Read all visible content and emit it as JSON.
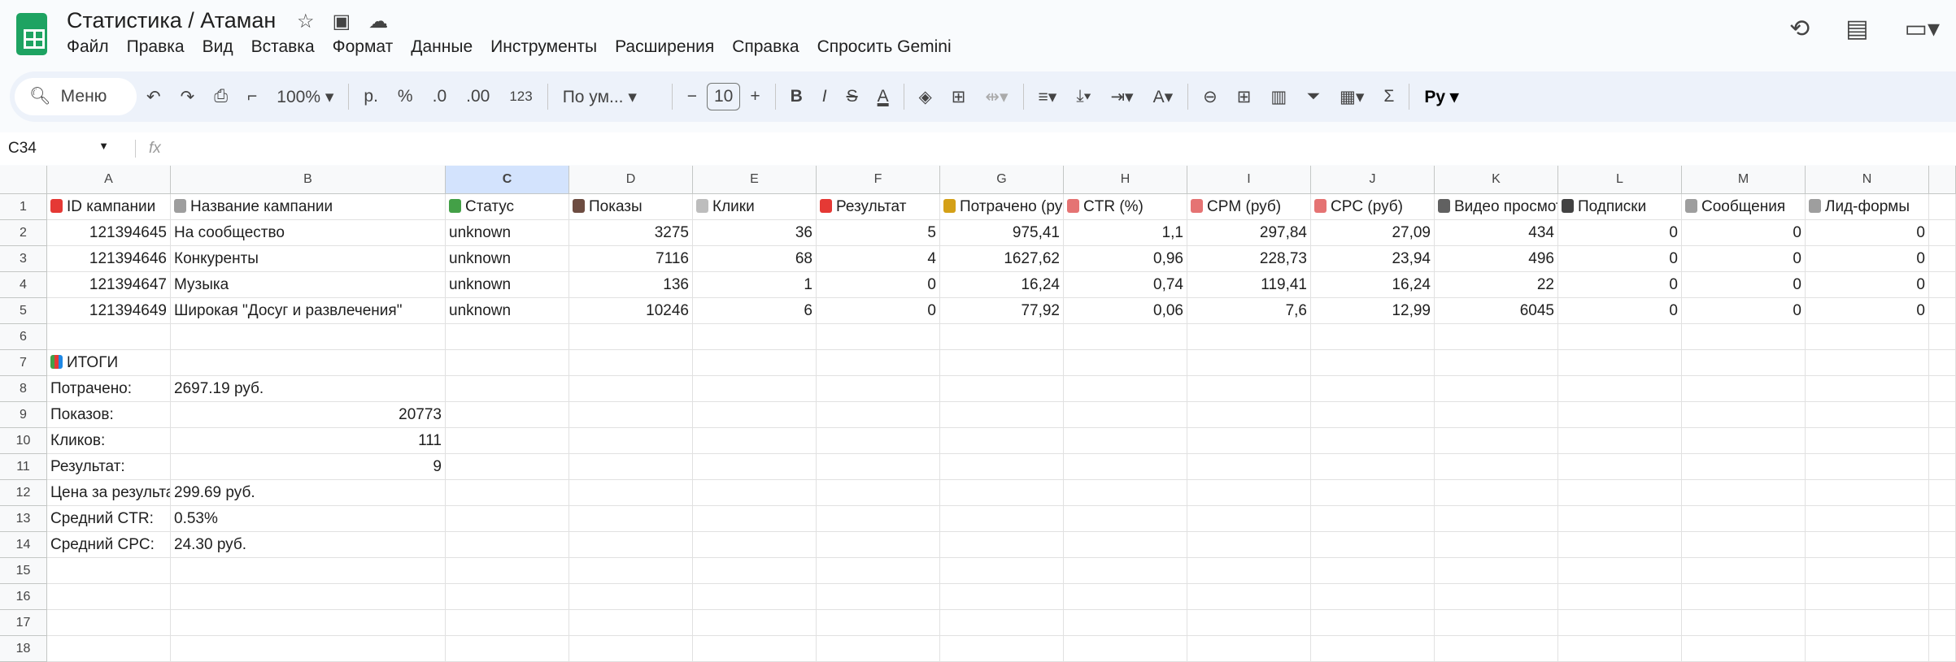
{
  "app": {
    "title": "Статистика / Атаман",
    "title_icons": [
      "star-icon",
      "move-to-folder-icon",
      "cloud-saved-icon"
    ],
    "right_icons": [
      "history-icon",
      "comments-icon",
      "meet-icon"
    ]
  },
  "menu": [
    "Файл",
    "Правка",
    "Вид",
    "Вставка",
    "Формат",
    "Данные",
    "Инструменты",
    "Расширения",
    "Справка",
    "Спросить Gemini"
  ],
  "toolbar": {
    "search": "Меню",
    "zoom": "100%",
    "currency": "р.",
    "percent": "%",
    "dec_minus": ".0",
    "dec_plus": ".00",
    "format": "123",
    "font": "По ум...",
    "font_size": "10"
  },
  "formula_bar": {
    "cell": "C34",
    "fx": "fx",
    "value": ""
  },
  "columns": [
    "A",
    "B",
    "C",
    "D",
    "E",
    "F",
    "G",
    "H",
    "I",
    "J",
    "K",
    "L",
    "M",
    "N"
  ],
  "selected_column": "C",
  "headers": [
    {
      "icon": "target-icon",
      "color": "#e53935",
      "label": "ID кампании"
    },
    {
      "icon": "clipboard-icon",
      "color": "#9e9e9e",
      "label": "Название кампании"
    },
    {
      "icon": "bar-chart-icon",
      "color": "#43a047",
      "label": "Статус"
    },
    {
      "icon": "eye-icon",
      "color": "#6d4c41",
      "label": "Показы"
    },
    {
      "icon": "mouse-icon",
      "color": "#bdbdbd",
      "label": "Клики"
    },
    {
      "icon": "target-icon",
      "color": "#e53935",
      "label": "Результат"
    },
    {
      "icon": "money-bag-icon",
      "color": "#d4a017",
      "label": "Потрачено (руб)"
    },
    {
      "icon": "chart-up-icon",
      "color": "#e57373",
      "label": "CTR (%)"
    },
    {
      "icon": "chart-up-icon",
      "color": "#e57373",
      "label": "CPM (руб)"
    },
    {
      "icon": "chart-up-icon",
      "color": "#e57373",
      "label": "CPC (руб)"
    },
    {
      "icon": "projector-icon",
      "color": "#616161",
      "label": "Видео просмотры"
    },
    {
      "icon": "people-icon",
      "color": "#424242",
      "label": "Подписки"
    },
    {
      "icon": "speech-bubble-icon",
      "color": "#9e9e9e",
      "label": "Сообщения"
    },
    {
      "icon": "clipboard-icon",
      "color": "#9e9e9e",
      "label": "Лид-формы"
    }
  ],
  "rows": [
    [
      "121394645",
      "На сообщество",
      "unknown",
      "3275",
      "36",
      "5",
      "975,41",
      "1,1",
      "297,84",
      "27,09",
      "434",
      "0",
      "0",
      "0"
    ],
    [
      "121394646",
      "Конкуренты",
      "unknown",
      "7116",
      "68",
      "4",
      "1627,62",
      "0,96",
      "228,73",
      "23,94",
      "496",
      "0",
      "0",
      "0"
    ],
    [
      "121394647",
      "Музыка",
      "unknown",
      "136",
      "1",
      "0",
      "16,24",
      "0,74",
      "119,41",
      "16,24",
      "22",
      "0",
      "0",
      "0"
    ],
    [
      "121394649",
      "Широкая \"Досуг и развлечения\"",
      "unknown",
      "10246",
      "6",
      "0",
      "77,92",
      "0,06",
      "7,6",
      "12,99",
      "6045",
      "0",
      "0",
      "0"
    ]
  ],
  "summary": {
    "title": "ИТОГИ",
    "items": [
      {
        "label": "Потрачено:",
        "value": "2697.19 руб.",
        "align": "left"
      },
      {
        "label": "Показов:",
        "value": "20773",
        "align": "right"
      },
      {
        "label": "Кликов:",
        "value": "111",
        "align": "right"
      },
      {
        "label": "Результат:",
        "value": "9",
        "align": "right"
      },
      {
        "label": "Цена за результат:",
        "value": "299.69 руб.",
        "align": "left"
      },
      {
        "label": "Средний CTR:",
        "value": "0.53%",
        "align": "left"
      },
      {
        "label": "Средний CPC:",
        "value": "24.30 руб.",
        "align": "left"
      }
    ]
  },
  "row_numbers": [
    "1",
    "2",
    "3",
    "4",
    "5",
    "6",
    "7",
    "8",
    "9",
    "10",
    "11",
    "12",
    "13",
    "14",
    "15",
    "16",
    "17",
    "18"
  ]
}
